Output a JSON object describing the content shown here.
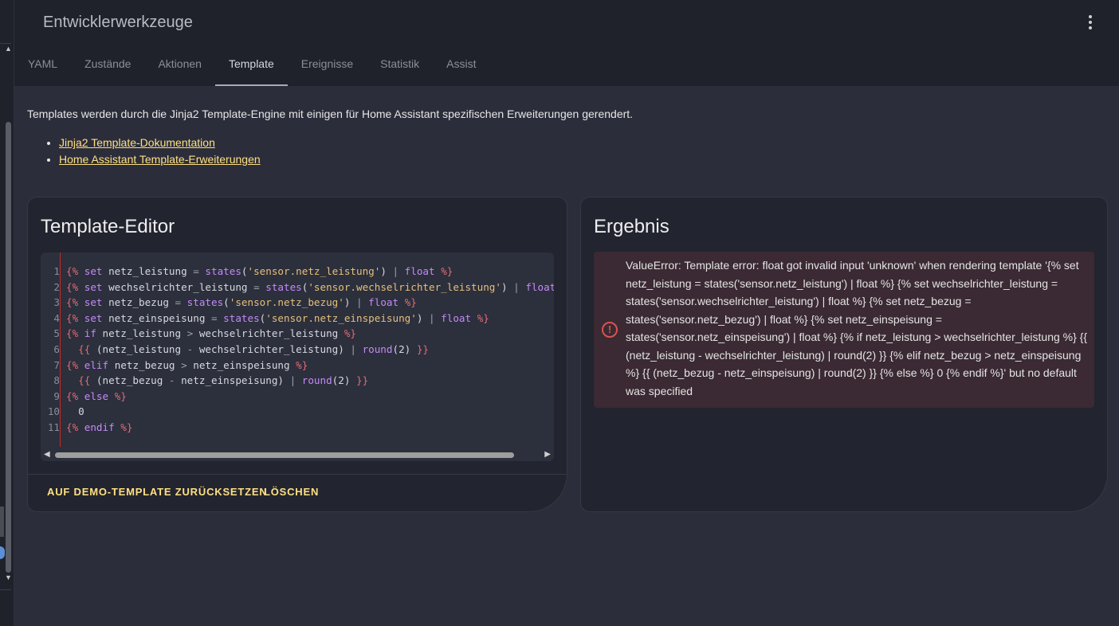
{
  "header": {
    "title": "Entwicklerwerkzeuge",
    "tabs": [
      "YAML",
      "Zustände",
      "Aktionen",
      "Template",
      "Ereignisse",
      "Statistik",
      "Assist"
    ],
    "active_tab": "Template"
  },
  "intro": {
    "text": "Templates werden durch die Jinja2 Template-Engine mit einigen für Home Assistant spezifischen Erweiterungen gerendert.",
    "links": [
      "Jinja2 Template-Dokumentation",
      "Home Assistant Template-Erweiterungen"
    ]
  },
  "editor": {
    "title": "Template-Editor",
    "line_numbers": [
      "1",
      "2",
      "3",
      "4",
      "5",
      "6",
      "7",
      "8",
      "9",
      "10",
      "11"
    ],
    "reset_label": "AUF DEMO-TEMPLATE ZURÜCKSETZEN",
    "clear_label": "LÖSCHEN"
  },
  "result": {
    "title": "Ergebnis",
    "error_text": "ValueError: Template error: float got invalid input 'unknown' when rendering template '{% set netz_leistung = states('sensor.netz_leistung') | float %} {% set wechselrichter_leistung = states('sensor.wechselrichter_leistung') | float %} {% set netz_bezug = states('sensor.netz_bezug') | float %} {% set netz_einspeisung = states('sensor.netz_einspeisung') | float %} {% if netz_leistung > wechselrichter_leistung %} {{ (netz_leistung - wechselrichter_leistung) | round(2) }} {% elif netz_bezug > netz_einspeisung %} {{ (netz_bezug - netz_einspeisung) | round(2) }} {% else %} 0 {% endif %}' but no default was specified"
  },
  "colors": {
    "accent": "#ffe082",
    "error": "#d9534f",
    "background": "#2b2d3a"
  }
}
